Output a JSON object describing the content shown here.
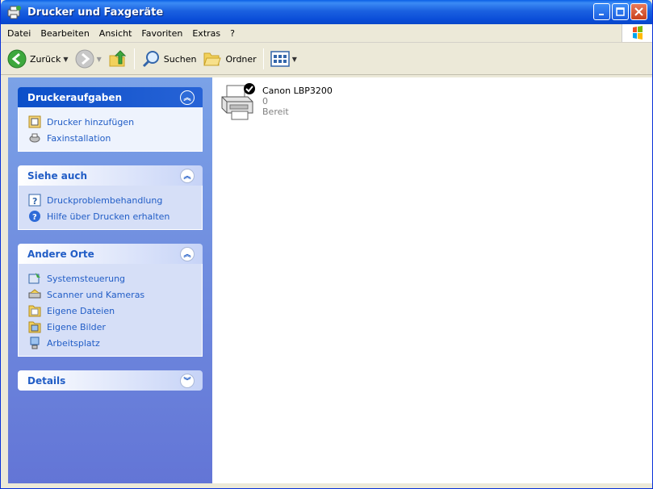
{
  "window": {
    "title": "Drucker und Faxgeräte"
  },
  "menu": [
    "Datei",
    "Bearbeiten",
    "Ansicht",
    "Favoriten",
    "Extras",
    "?"
  ],
  "toolbar": {
    "back_label": "Zurück",
    "search_label": "Suchen",
    "folders_label": "Ordner"
  },
  "panels": {
    "tasks": {
      "title": "Druckeraufgaben",
      "links": [
        "Drucker hinzufügen",
        "Faxinstallation"
      ]
    },
    "see_also": {
      "title": "Siehe auch",
      "links": [
        "Druckproblembehandlung",
        "Hilfe über Drucken erhalten"
      ]
    },
    "other_places": {
      "title": "Andere Orte",
      "links": [
        "Systemsteuerung",
        "Scanner und Kameras",
        "Eigene Dateien",
        "Eigene Bilder",
        "Arbeitsplatz"
      ]
    },
    "details": {
      "title": "Details"
    }
  },
  "printers": [
    {
      "name": "Canon LBP3200",
      "documents": "0",
      "status": "Bereit",
      "icon": "printer-default-icon"
    }
  ],
  "colors": {
    "titlebar": "#0A4DD8",
    "sidebar_top": "#7BA2E7",
    "sidebar_bottom": "#6375D6",
    "panel_title": "#215DC6",
    "link": "#215DC6"
  }
}
